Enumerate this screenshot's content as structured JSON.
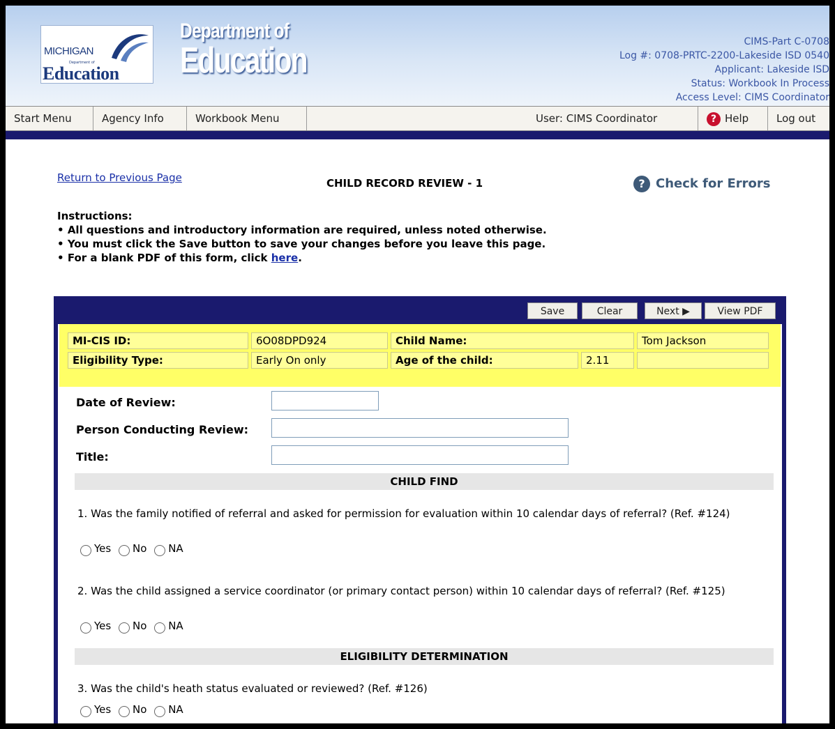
{
  "header": {
    "logo": {
      "state": "MICHIGAN",
      "small": "Department of",
      "name": "Education"
    },
    "dept_line1": "Department of",
    "dept_line2": "Education",
    "status": [
      "CIMS-Part C-0708",
      "Log #: 0708-PRTC-2200-Lakeside ISD 0540",
      "Applicant: Lakeside ISD",
      "Status: Workbook In Process",
      "Access Level: CIMS Coordinator"
    ]
  },
  "nav": {
    "start": "Start Menu",
    "agency": "Agency Info",
    "workbook": "Workbook Menu",
    "user": "User: CIMS Coordinator",
    "help": "Help",
    "logout": "Log out"
  },
  "page": {
    "return_link": "Return to Previous Page",
    "title": "CHILD RECORD REVIEW - 1",
    "check_errors": "Check for Errors",
    "instructions_heading": "Instructions:",
    "instructions": [
      "All questions and introductory information are required, unless noted otherwise.",
      "You must click the Save button to save your changes before you leave this page."
    ],
    "pdf_prefix": "For a blank PDF of this form, click ",
    "pdf_link": "here",
    "pdf_suffix": "."
  },
  "toolbar": {
    "save": "Save",
    "clear": "Clear",
    "next": "Next ▶",
    "view_pdf": "View PDF"
  },
  "child": {
    "micis_label": "MI-CIS ID:",
    "micis_value": "6O08DPD924",
    "name_label": "Child Name:",
    "name_value": "Tom Jackson",
    "elig_label": "Eligibility Type:",
    "elig_value": "Early On only",
    "age_label": "Age of the child:",
    "age_value": "2.11"
  },
  "fields": {
    "date_label": "Date of Review:",
    "person_label": "Person Conducting Review:",
    "title_label": "Title:"
  },
  "sections": {
    "child_find": "CHILD FIND",
    "eligibility": "ELIGIBILITY DETERMINATION"
  },
  "questions": [
    "1. Was the family notified of referral and asked for permission for evaluation within 10 calendar days of referral? (Ref. #124)",
    "2. Was the child assigned a service coordinator (or primary contact person) within 10 calendar days of referral? (Ref. #125)",
    "3. Was the child's heath status evaluated or reviewed? (Ref. #126)"
  ],
  "options": {
    "yes": "Yes",
    "no": "No",
    "na": "NA"
  }
}
